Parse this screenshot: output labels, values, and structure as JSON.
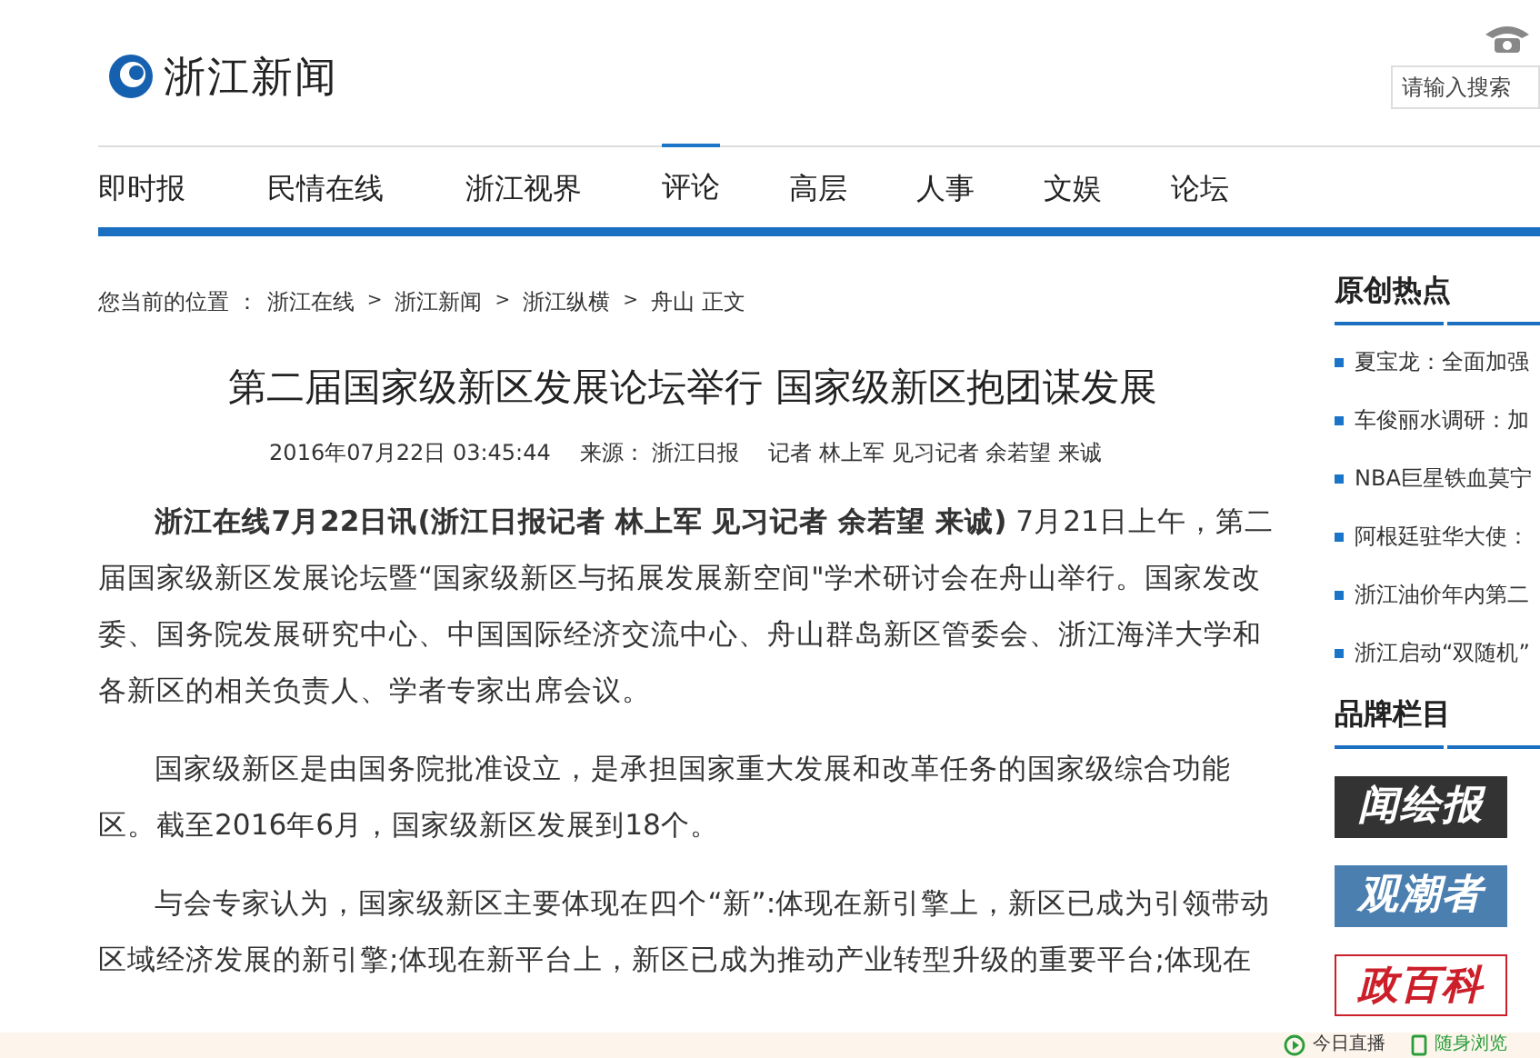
{
  "header": {
    "logo": "浙江新闻",
    "search": {
      "placeholder": "请输入搜索"
    }
  },
  "nav": [
    {
      "label": "即时报",
      "selected": false
    },
    {
      "label": "民情在线",
      "selected": false
    },
    {
      "label": "浙江视界",
      "selected": false
    },
    {
      "label": "评论",
      "selected": true
    },
    {
      "label": "高层",
      "selected": false
    },
    {
      "label": "人事",
      "selected": false
    },
    {
      "label": "文娱",
      "selected": false
    },
    {
      "label": "论坛",
      "selected": false
    }
  ],
  "breadcrumb": {
    "prefix": "您当前的位置 ：",
    "items": [
      "浙江在线",
      "浙江新闻",
      "浙江纵横",
      "舟山 正文"
    ],
    "separator": ">"
  },
  "article": {
    "title": "第二届国家级新区发展论坛举行 国家级新区抱团谋发展",
    "date": "2016年07月22日 03:45:44",
    "source": "来源： 浙江日报",
    "authors": "记者 林上军 见习记者 余若望 来诚",
    "paragraphs": [
      "**浙江在线7月22日讯(浙江日报记者 林上军 见习记者 余若望 来诚)** 7月21日上午，第二届国家级新区发展论坛暨“国家级新区与拓展发展新空间\"学术研讨会在舟山举行。国家发改委、国务院发展研究中心、中国国际经济交流中心、舟山群岛新区管委会、浙江海洋大学和各新区的相关负责人、学者专家出席会议。",
      "国家级新区是由国务院批准设立，是承担国家重大发展和改革任务的国家级综合功能区。截至2016年6月，国家级新区发展到18个。",
      "与会专家认为，国家级新区主要体现在四个“新”:体现在新引擎上，新区已成为引领带动区域经济发展的新引擎;体现在新平台上，新区已成为推动产业转型升级的重要平台;体现在"
    ]
  },
  "sidebar": {
    "hot_title": "原创热点",
    "hot_items": [
      "夏宝龙：全面加强",
      "车俊丽水调研：加",
      "NBA巨星铁血莫宁",
      "阿根廷驻华大使：",
      "浙江油价年内第二",
      "浙江启动“双随机”"
    ],
    "brand_title": "品牌栏目",
    "brands": [
      {
        "name": "闻绘报",
        "color": "#333333"
      },
      {
        "name": "观潮者",
        "color": "#4a7fb0"
      },
      {
        "name": "政百科",
        "color": "#cc1f2a"
      }
    ]
  },
  "bottom_bar": [
    "今日直播",
    "随身浏览"
  ]
}
